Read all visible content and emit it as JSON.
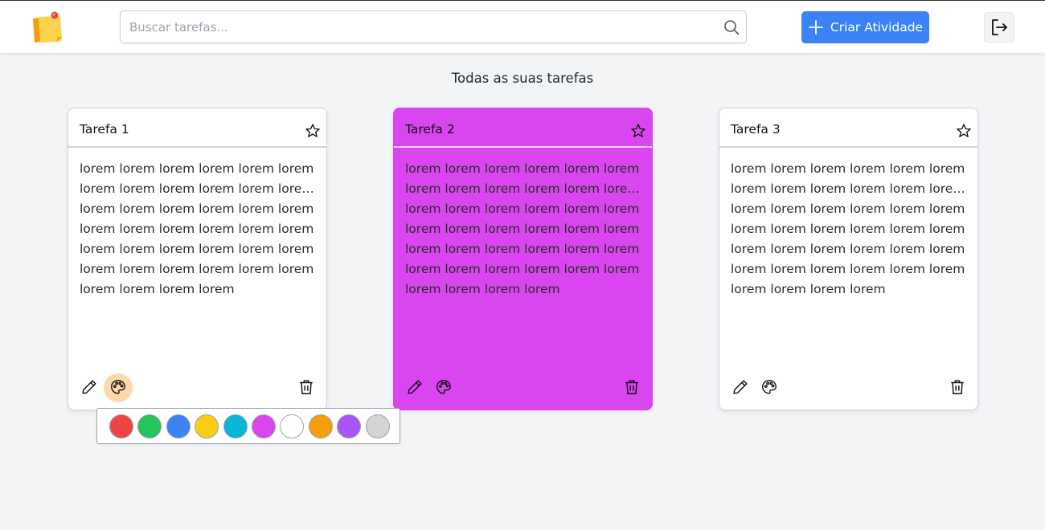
{
  "app": {
    "logo_icon": "sticky-note-icon"
  },
  "search": {
    "placeholder": "Buscar tarefas...",
    "value": "",
    "icon": "search-icon"
  },
  "header": {
    "create_label": "Criar Atividade",
    "create_icon": "plus-icon",
    "logout_icon": "logout-icon",
    "accent": "#3b82f6"
  },
  "page": {
    "heading": "Todas as suas tarefas"
  },
  "tasks": [
    {
      "title": "Tarefa 1",
      "lines": [
        "lorem lorem lorem lorem lorem lorem",
        "lorem lorem lorem lorem lorem lorem …",
        "lorem lorem lorem lorem lorem lorem",
        "lorem lorem lorem lorem lorem lorem",
        "lorem lorem lorem lorem lorem lorem",
        "lorem lorem lorem lorem lorem lorem",
        "lorem lorem lorem lorem"
      ],
      "color": "#ffffff",
      "palette_open": true
    },
    {
      "title": "Tarefa 2",
      "lines": [
        "lorem lorem lorem lorem lorem lorem",
        "lorem lorem lorem lorem lorem lorem …",
        "lorem lorem lorem lorem lorem lorem",
        "lorem lorem lorem lorem lorem lorem",
        "lorem lorem lorem lorem lorem lorem",
        "lorem lorem lorem lorem lorem lorem",
        "lorem lorem lorem lorem"
      ],
      "color": "#d946ef",
      "palette_open": false
    },
    {
      "title": "Tarefa 3",
      "lines": [
        "lorem lorem lorem lorem lorem lorem",
        "lorem lorem lorem lorem lorem lorem …",
        "lorem lorem lorem lorem lorem lorem",
        "lorem lorem lorem lorem lorem lorem",
        "lorem lorem lorem lorem lorem lorem",
        "lorem lorem lorem lorem lorem lorem",
        "lorem lorem lorem lorem"
      ],
      "color": "#ffffff",
      "palette_open": false
    }
  ],
  "card_icons": [
    "star-icon",
    "pencil-icon",
    "palette-icon",
    "trash-icon"
  ],
  "color_options": [
    "#ef4444",
    "#22c55e",
    "#3b82f6",
    "#facc15",
    "#06b6d4",
    "#d946ef",
    "#ffffff",
    "#f59e0b",
    "#a855f7",
    "#d4d4d4"
  ]
}
